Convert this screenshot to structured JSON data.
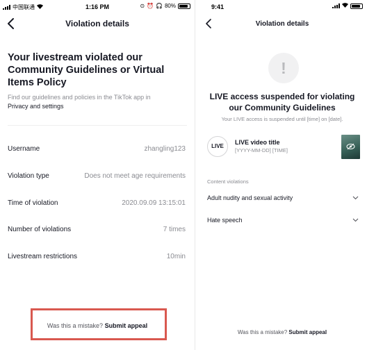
{
  "left": {
    "status": {
      "carrier": "中国联通",
      "time": "1:16 PM",
      "battery": "80%"
    },
    "title": "Violation details",
    "headline": "Your livestream violated our Community Guidelines or Virtual Items Policy",
    "subtext": "Find our guidelines and policies in the TikTok app in",
    "subtext_link": "Privacy and settings",
    "rows": [
      {
        "label": "Username",
        "value": "zhangling123"
      },
      {
        "label": "Violation type",
        "value": "Does not meet age requirements"
      },
      {
        "label": "Time of violation",
        "value": "2020.09.09 13:15:01"
      },
      {
        "label": "Number of violations",
        "value": "7 times"
      },
      {
        "label": "Livestream restrictions",
        "value": "10min"
      }
    ],
    "appeal_question": "Was this a mistake?",
    "appeal_action": "Submit appeal"
  },
  "right": {
    "status": {
      "time": "9:41"
    },
    "title": "Violation details",
    "warning_glyph": "!",
    "headline": "LIVE access suspended for violating our Community Guidelines",
    "subtext": "Your LIVE access is suspended until [time] on [date].",
    "live_badge": "LIVE",
    "video_title": "LIVE video title",
    "video_date": "[YYYY-MM-DD] [TIME]",
    "section_label": "Content violations",
    "violations": [
      "Adult nudity and sexual activity",
      "Hate speech"
    ],
    "bottom_question": "Was this a mistake?",
    "bottom_action": "Submit appeal"
  },
  "icons": {
    "back": "chevron-left-icon",
    "expand": "chevron-down-icon",
    "warning": "exclamation-icon",
    "hidden": "eye-slash-icon"
  },
  "colors": {
    "highlight_border": "#d9584f",
    "muted_text": "#8a8b91",
    "primary_text": "#161823"
  }
}
